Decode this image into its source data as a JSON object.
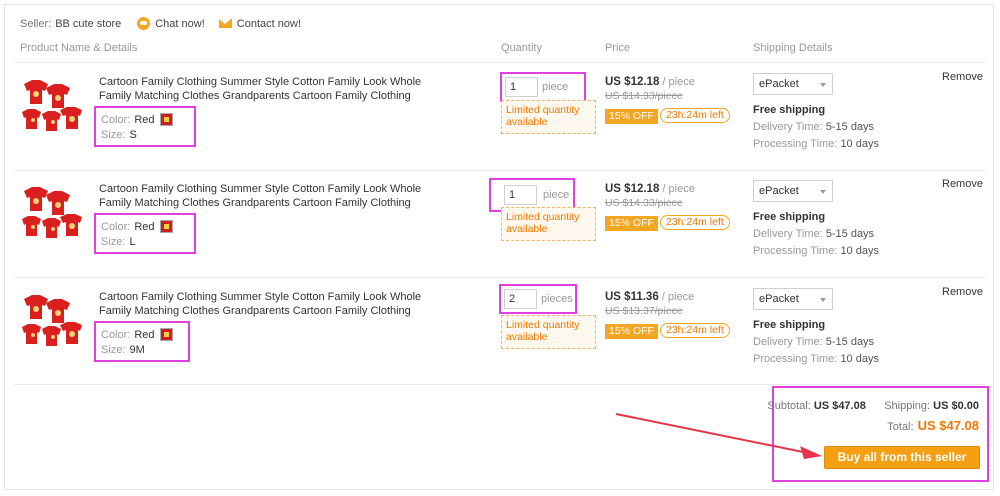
{
  "seller": {
    "label": "Seller:",
    "name": "BB cute store",
    "chat_label": "Chat now!",
    "contact_label": "Contact now!"
  },
  "headers": {
    "product": "Product Name & Details",
    "quantity": "Quantity",
    "price": "Price",
    "shipping": "Shipping Details"
  },
  "items": [
    {
      "title": "Cartoon Family Clothing Summer Style Cotton Family Look Whole Family Matching Clothes Grandparents Cartoon Family Clothing",
      "color_label": "Color:",
      "color": "Red",
      "size_label": "Size:",
      "size": "S",
      "qty": "1",
      "qty_unit": "piece",
      "limited": "Limited quantity available",
      "price": "US $12.18",
      "price_unit": "/ piece",
      "orig_price": "US $14.33/piece",
      "discount": "15% OFF",
      "timer": "23h:24m left",
      "shipping_method": "ePacket",
      "free_shipping": "Free shipping",
      "delivery_label": "Delivery Time:",
      "delivery": "5-15 days",
      "processing_label": "Processing Time:",
      "processing": "10 days",
      "remove": "Remove"
    },
    {
      "title": "Cartoon Family Clothing Summer Style Cotton Family Look Whole Family Matching Clothes Grandparents Cartoon Family Clothing",
      "color_label": "Color:",
      "color": "Red",
      "size_label": "Size:",
      "size": "L",
      "qty": "1",
      "qty_unit": "piece",
      "limited": "Limited quantity available",
      "price": "US $12.18",
      "price_unit": "/ piece",
      "orig_price": "US $14.33/piece",
      "discount": "15% OFF",
      "timer": "23h:24m left",
      "shipping_method": "ePacket",
      "free_shipping": "Free shipping",
      "delivery_label": "Delivery Time:",
      "delivery": "5-15 days",
      "processing_label": "Processing Time:",
      "processing": "10 days",
      "remove": "Remove"
    },
    {
      "title": "Cartoon Family Clothing Summer Style Cotton Family Look Whole Family Matching Clothes Grandparents Cartoon Family Clothing",
      "color_label": "Color:",
      "color": "Red",
      "size_label": "Size:",
      "size": "9M",
      "qty": "2",
      "qty_unit": "pieces",
      "limited": "Limited quantity available",
      "price": "US $11.36",
      "price_unit": "/ piece",
      "orig_price": "US $13.37/piece",
      "discount": "15% OFF",
      "timer": "23h:24m left",
      "shipping_method": "ePacket",
      "free_shipping": "Free shipping",
      "delivery_label": "Delivery Time:",
      "delivery": "5-15 days",
      "processing_label": "Processing Time:",
      "processing": "10 days",
      "remove": "Remove"
    }
  ],
  "summary": {
    "subtotal_label": "Subtotal:",
    "subtotal": "US $47.08",
    "shipping_label": "Shipping:",
    "shipping": "US $0.00",
    "total_label": "Total:",
    "total": "US $47.08",
    "buy_label": "Buy all from this seller"
  },
  "colors": {
    "accent": "#f5a011",
    "highlight": "#e040e0",
    "arrow": "#e8334a"
  },
  "icons": {
    "chat": "chat-bubble-icon",
    "contact": "mail-icon",
    "dropdown": "chevron-down-icon"
  }
}
